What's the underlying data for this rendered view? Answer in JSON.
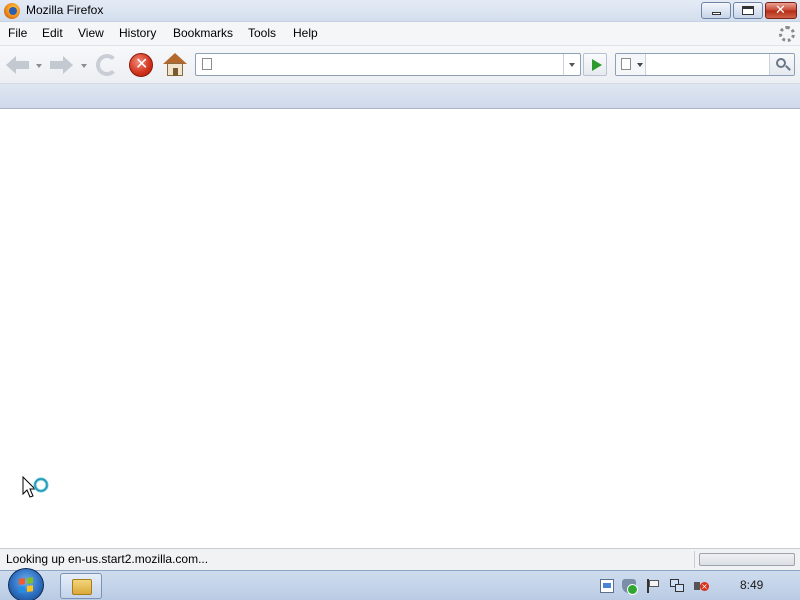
{
  "window": {
    "title": "Mozilla Firefox",
    "buttons": {
      "minimize": "",
      "maximize": "",
      "close": "✕"
    }
  },
  "menubar": {
    "items": [
      "File",
      "Edit",
      "View",
      "History",
      "Bookmarks",
      "Tools",
      "Help"
    ]
  },
  "navbar": {
    "url_value": "",
    "url_placeholder": "",
    "search_value": "",
    "search_placeholder": "",
    "stop_symbol": "✕"
  },
  "statusbar": {
    "text": "Looking up en-us.start2.mozilla.com..."
  },
  "taskbar": {
    "clock": "8:49",
    "volume_mute_symbol": "×"
  },
  "icons": {
    "app": "firefox-icon",
    "throbber": "loading-throbber-icon",
    "back": "back-arrow-icon",
    "forward": "forward-arrow-icon",
    "reload": "reload-icon",
    "stop": "stop-icon",
    "home": "home-icon",
    "go": "go-arrow-icon",
    "search": "magnifier-icon",
    "cursor": "busy-cursor-icon"
  },
  "colors": {
    "stop_red": "#d0321a",
    "go_green": "#2e9a2e",
    "titlebar": "#d3deed",
    "taskbar": "#b9cbe4"
  }
}
